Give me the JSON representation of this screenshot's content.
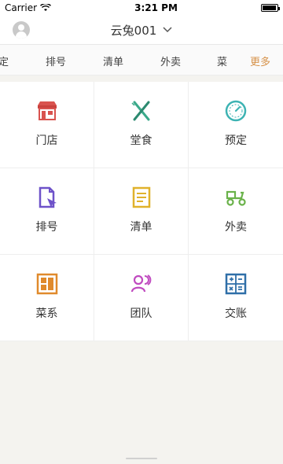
{
  "status": {
    "carrier": "Carrier",
    "time": "3:21 PM"
  },
  "nav": {
    "title": "云兔001"
  },
  "tabs": [
    "定",
    "排号",
    "清单",
    "外卖",
    "菜"
  ],
  "more": "更多",
  "grid": [
    {
      "label": "门店",
      "icon": "store-icon",
      "color": "#d9534f"
    },
    {
      "label": "堂食",
      "icon": "fork-knife-icon",
      "color": "#3aa98a"
    },
    {
      "label": "预定",
      "icon": "clock-dial-icon",
      "color": "#3db3b3"
    },
    {
      "label": "排号",
      "icon": "ticket-icon",
      "color": "#6e52c9"
    },
    {
      "label": "清单",
      "icon": "list-doc-icon",
      "color": "#e0b22c"
    },
    {
      "label": "外卖",
      "icon": "scooter-icon",
      "color": "#6ab24a"
    },
    {
      "label": "菜系",
      "icon": "menu-grid-icon",
      "color": "#e08a2c"
    },
    {
      "label": "团队",
      "icon": "team-icon",
      "color": "#c04bc0"
    },
    {
      "label": "交账",
      "icon": "calculator-icon",
      "color": "#2f6fa8"
    }
  ]
}
